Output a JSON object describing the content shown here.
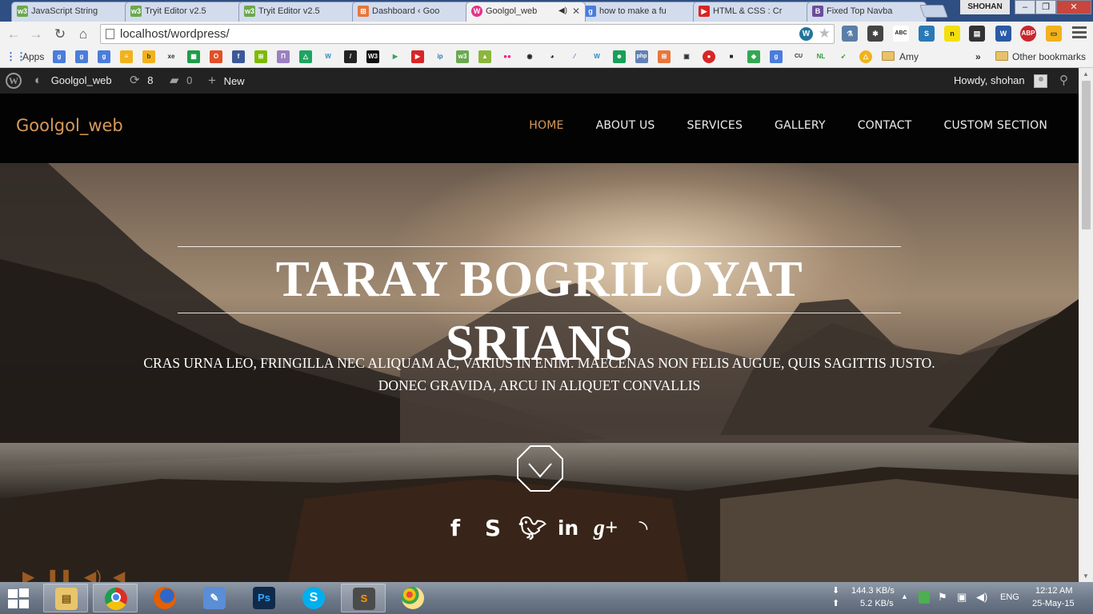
{
  "browser": {
    "tabs": [
      {
        "label": "JavaScript String",
        "favicon": "w3",
        "color": "#6aa84f"
      },
      {
        "label": "Tryit Editor v2.5",
        "favicon": "w3",
        "color": "#6aa84f"
      },
      {
        "label": "Tryit Editor v2.5",
        "favicon": "w3",
        "color": "#6aa84f"
      },
      {
        "label": "Dashboard ‹ Goo",
        "favicon": "wp-square",
        "color": "#e8763a"
      },
      {
        "label": "Goolgol_web",
        "favicon": "wp-circle",
        "color": "#e0338a",
        "active": true
      },
      {
        "label": "how to make a fu",
        "favicon": "g",
        "color": "#4a7ddb"
      },
      {
        "label": "HTML & CSS : Cr",
        "favicon": "youtube",
        "color": "#d92525"
      },
      {
        "label": "Fixed Top Navba",
        "favicon": "bootstrap",
        "color": "#6a4d9c"
      }
    ],
    "profile_name": "SHOHAN",
    "url": "localhost/wordpress/"
  },
  "bookmarks": {
    "apps_label": "Apps",
    "folder_label": "Amy",
    "overflow": "»",
    "other_label": "Other bookmarks"
  },
  "adminbar": {
    "site_name": "Goolgol_web",
    "updates_count": "8",
    "comments_count": "0",
    "new_label": "New",
    "greeting": "Howdy, shohan"
  },
  "site": {
    "brand": "Goolgol_web",
    "nav": [
      "HOME",
      "ABOUT US",
      "SERVICES",
      "GALLERY",
      "CONTACT",
      "CUSTOM SECTION"
    ],
    "nav_active_color": "#d89a5a",
    "hero_title": "TARAY BOGRILOYAT SRIANS",
    "hero_subtitle": "CRAS URNA LEO, FRINGILLA NEC ALIQUAM AC, VARIUS IN ENIM. MAECENAS NON FELIS AUGUE, QUIS SAGITTIS JUSTO. DONEC GRAVIDA, ARCU IN ALIQUET CONVALLIS",
    "social_icons": [
      "facebook-icon",
      "skype-icon",
      "twitter-icon",
      "linkedin-icon",
      "google-plus-icon",
      "rss-icon"
    ],
    "player_controls": [
      "play-icon",
      "pause-icon",
      "volume-up-icon",
      "volume-off-icon"
    ]
  },
  "taskbar": {
    "apps": [
      "file-explorer",
      "chrome",
      "firefox",
      "notepad",
      "photoshop",
      "skype",
      "sublime-text",
      "paint"
    ],
    "download_speed": "144.3 KB/s",
    "upload_speed": "5.2 KB/s",
    "language": "ENG",
    "time": "12:12 AM",
    "date": "25-May-15"
  }
}
